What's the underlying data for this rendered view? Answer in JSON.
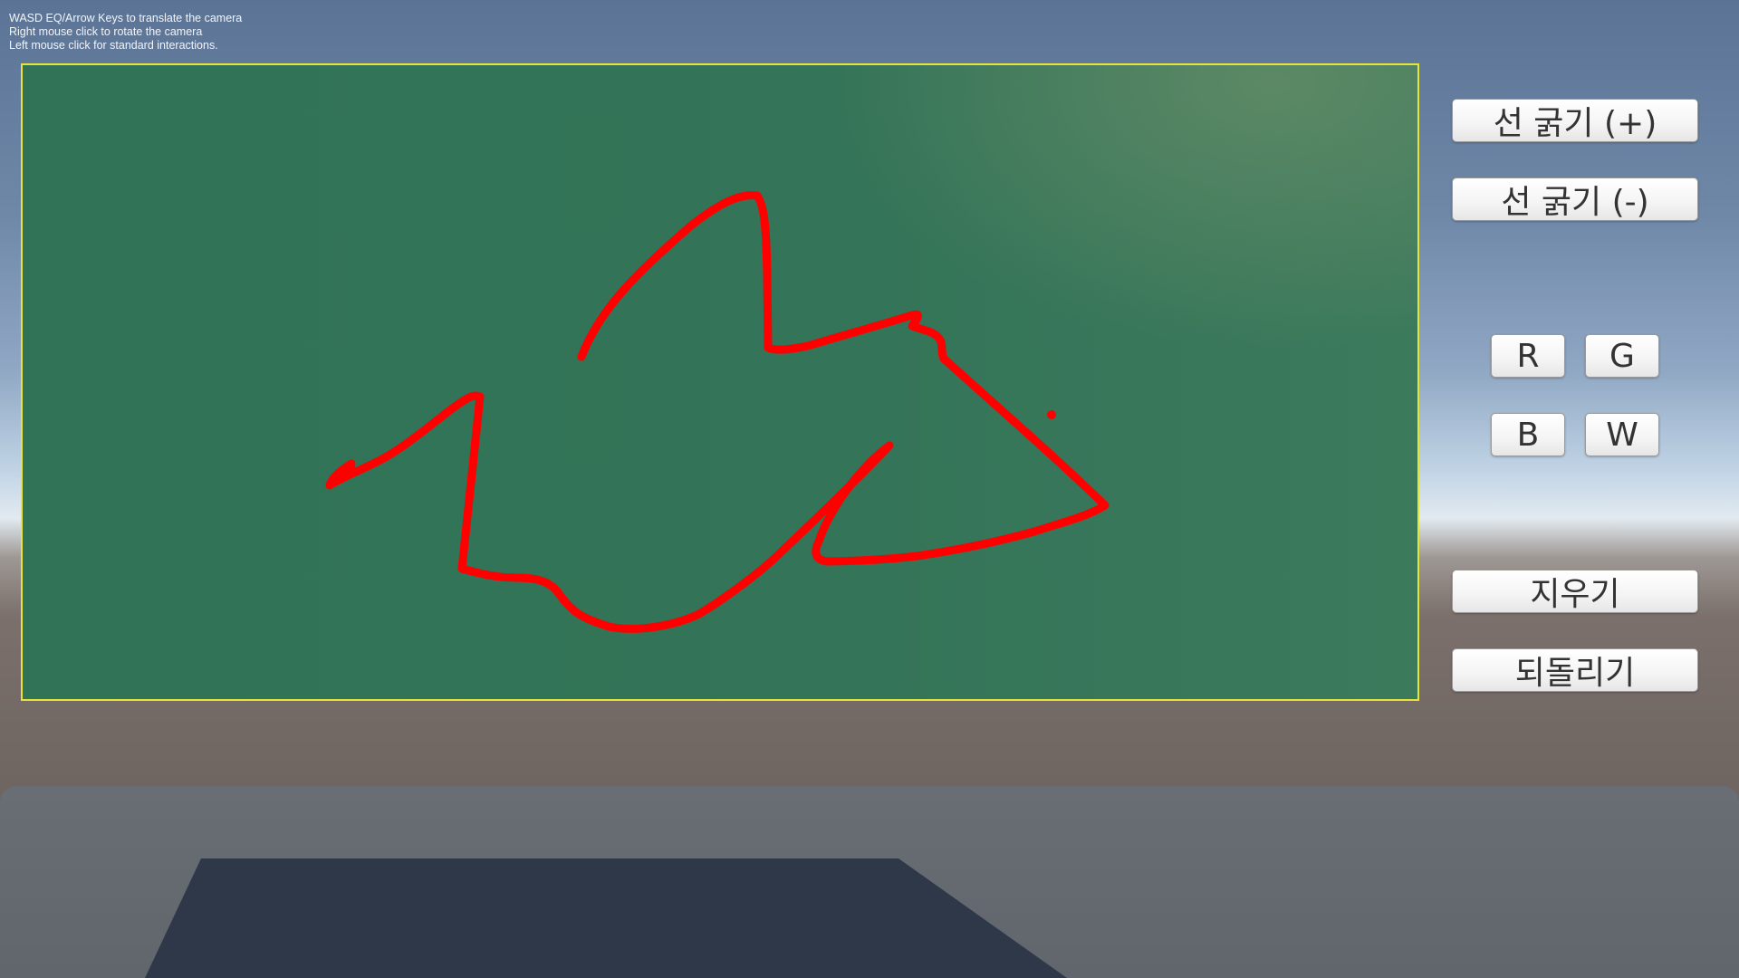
{
  "help": {
    "line1": "WASD EQ/Arrow Keys to translate the camera",
    "line2": "Right mouse click to rotate the camera",
    "line3": "Left mouse click for standard interactions."
  },
  "board": {
    "border_color": "#e6e43a",
    "surface_color": "#347458",
    "stroke_color": "#ff0000"
  },
  "panel": {
    "thicker_label": "선 굵기 (+)",
    "thinner_label": "선 굵기 (-)",
    "color_r_label": "R",
    "color_g_label": "G",
    "color_b_label": "B",
    "color_w_label": "W",
    "erase_label": "지우기",
    "undo_label": "되돌리기"
  }
}
